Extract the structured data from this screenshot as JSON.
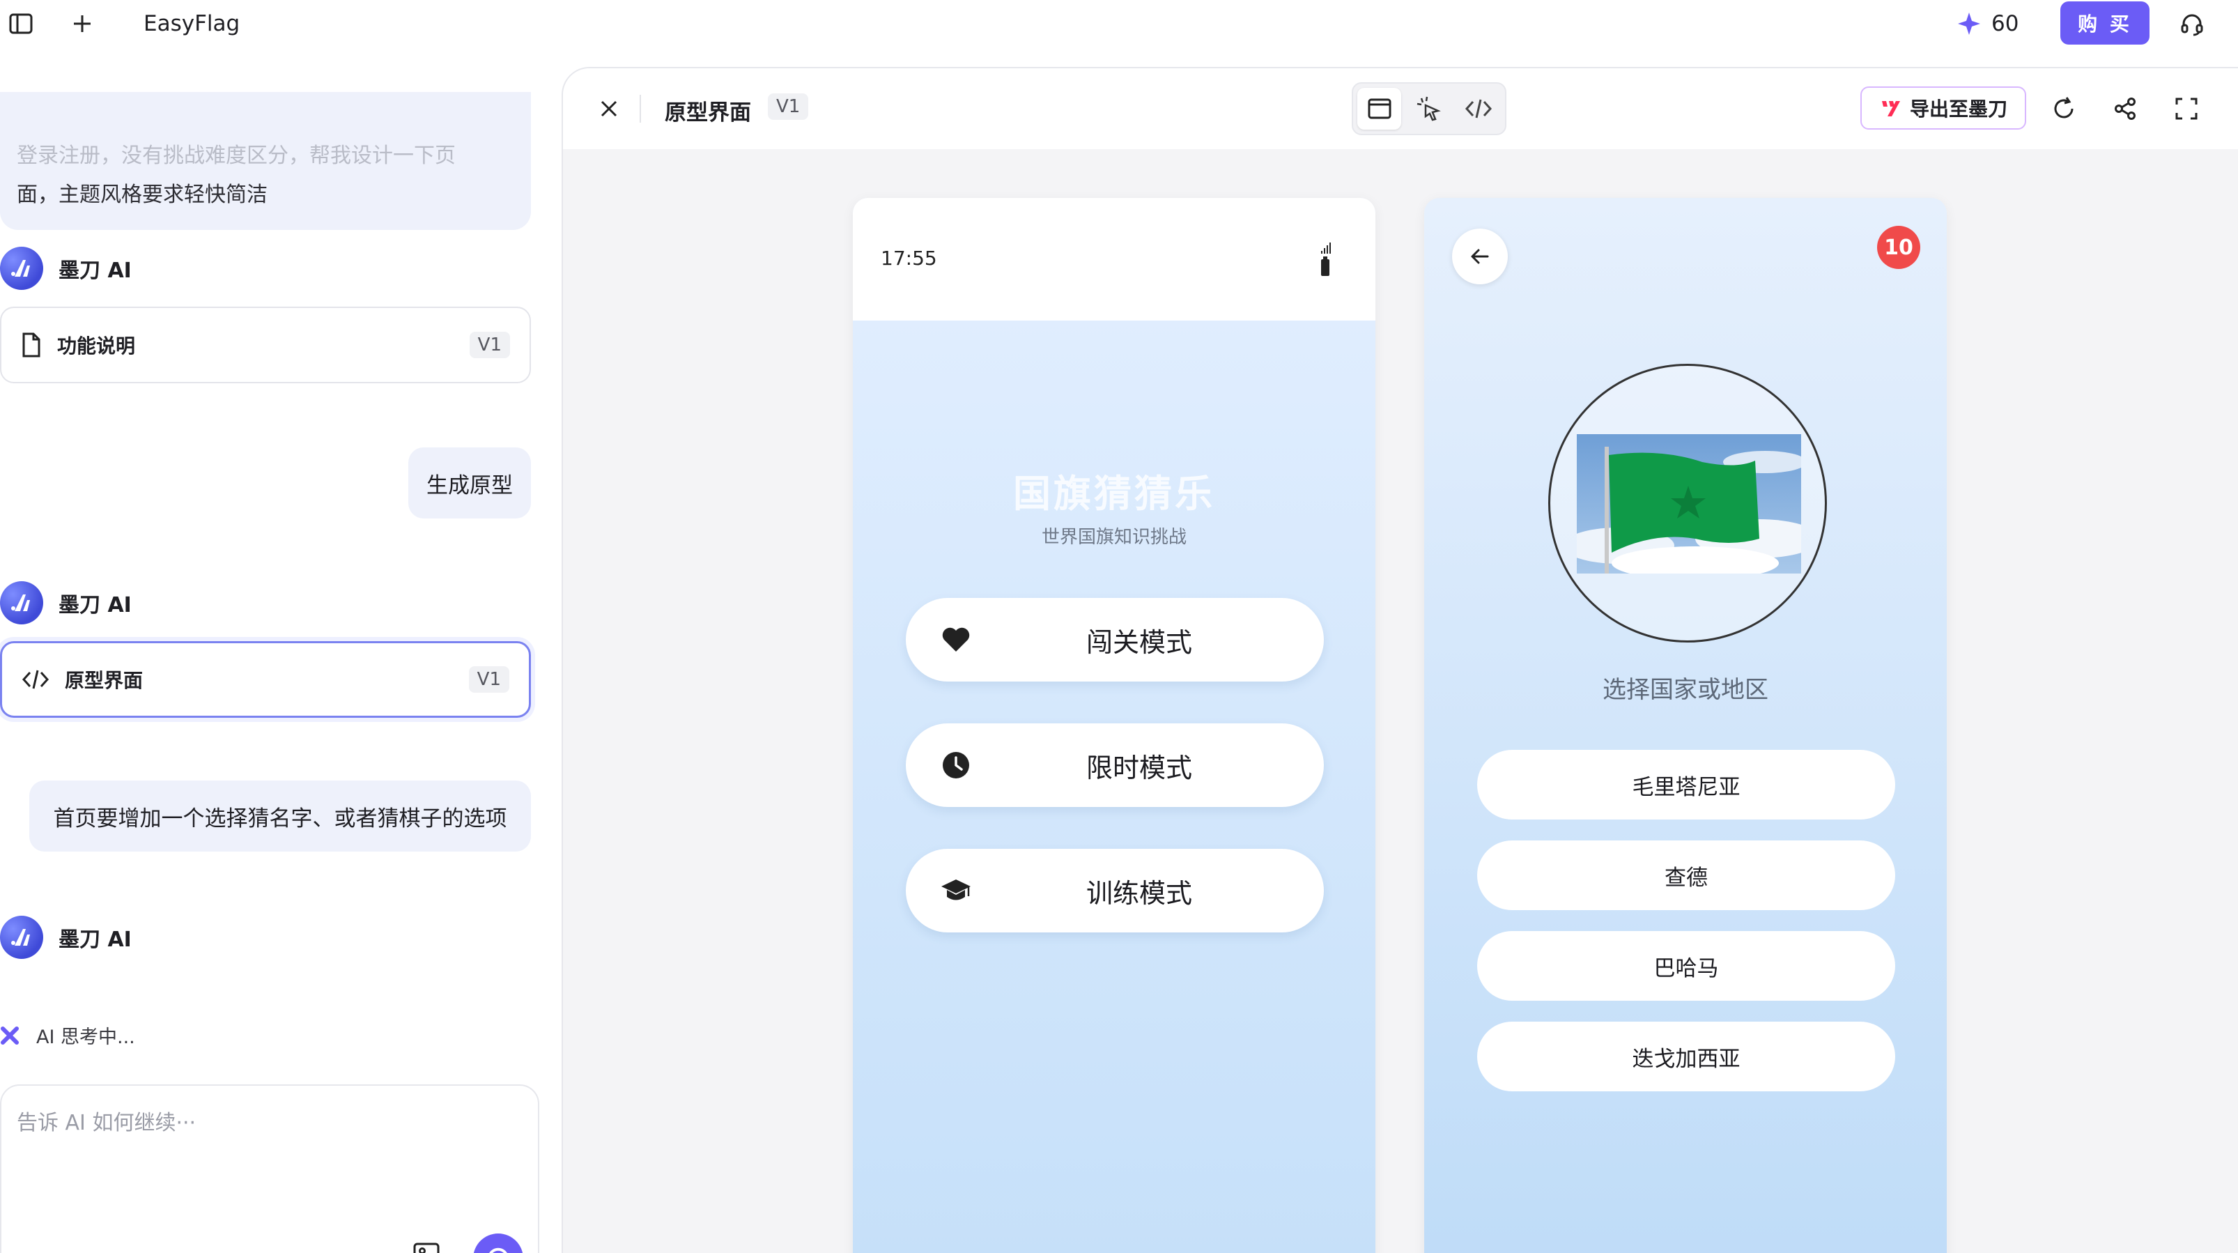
{
  "topbar": {
    "app_title": "EasyFlag",
    "credits": "60",
    "buy_label": "购 买"
  },
  "chat": {
    "prev_message_line1": "登录注册，没有挑战难度区分，帮我设计一下页",
    "prev_message_line2": "面，主题风格要求轻快简洁",
    "ai_name": "墨刀 AI",
    "cards": [
      {
        "label": "功能说明",
        "version": "V1"
      },
      {
        "label": "原型界面",
        "version": "V1"
      }
    ],
    "user_messages": [
      "生成原型",
      "首页要增加一个选择猜名字、或者猜棋子的选项"
    ],
    "thinking_text": "AI 思考中...",
    "input_placeholder": "告诉 AI 如何继续···"
  },
  "preview": {
    "title": "原型界面",
    "version": "V1",
    "export_label": "导出至墨刀",
    "home_screen": {
      "time": "17:55",
      "title": "国旗猜猜乐",
      "subtitle": "世界国旗知识挑战",
      "modes": [
        {
          "label": "闯关模式",
          "icon": "heart-icon"
        },
        {
          "label": "限时模式",
          "icon": "clock-icon"
        },
        {
          "label": "训练模式",
          "icon": "graduation-cap-icon"
        }
      ]
    },
    "quiz_screen": {
      "badge_count": "10",
      "prompt": "选择国家或地区",
      "options": [
        "毛里塔尼亚",
        "查德",
        "巴哈马",
        "迭戈加西亚"
      ]
    }
  },
  "colors": {
    "accent": "#6b5cf6",
    "badge": "#f04a4a",
    "flag_green": "#0f9a48"
  }
}
